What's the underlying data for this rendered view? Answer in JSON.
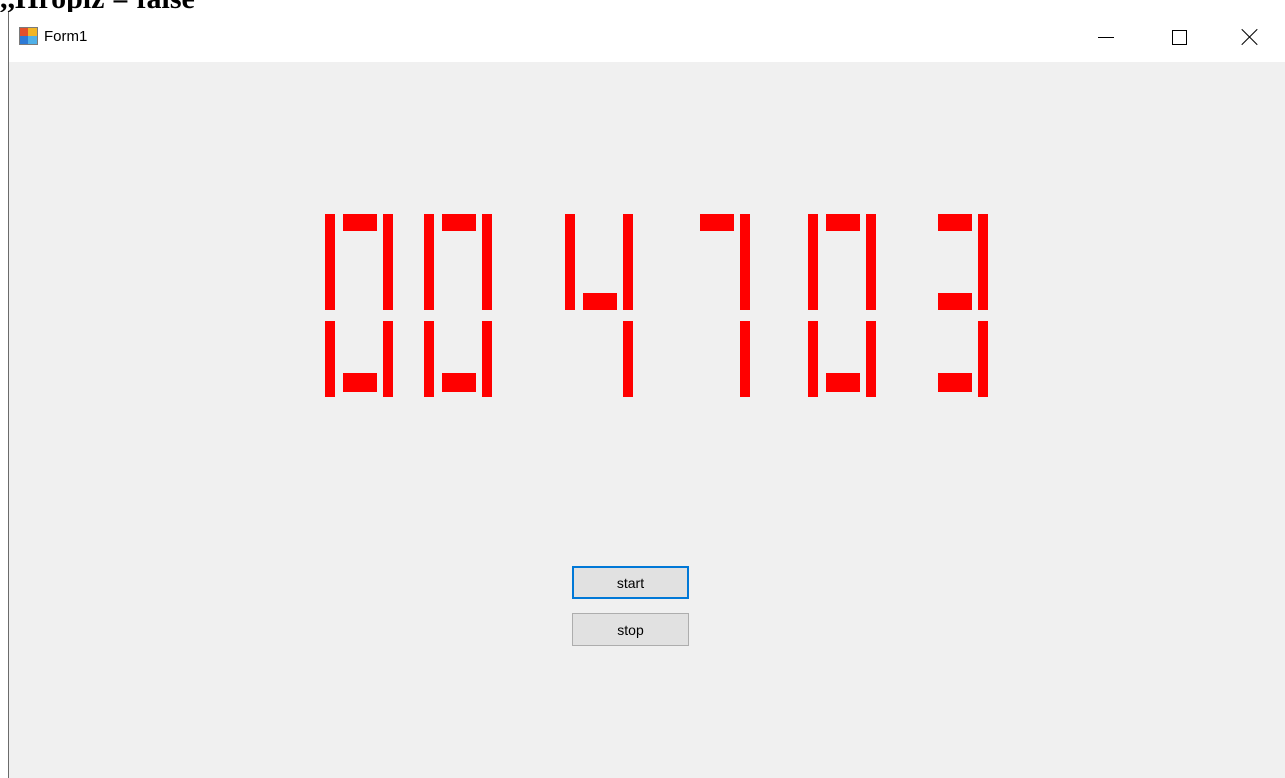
{
  "document_fragment": ",,Hropiz = false",
  "window": {
    "title": "Form1",
    "controls": {
      "minimize": "minimize-icon",
      "maximize": "maximize-icon",
      "close": "close-icon"
    }
  },
  "display": {
    "value": "004703",
    "color": "#ff0000"
  },
  "buttons": {
    "start": "start",
    "stop": "stop"
  }
}
